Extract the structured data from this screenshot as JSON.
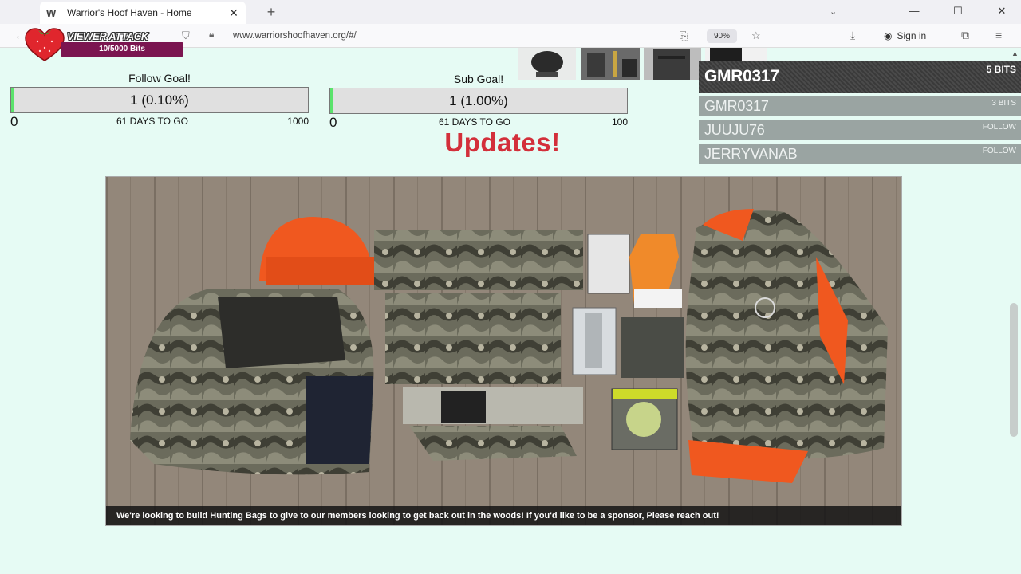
{
  "browser": {
    "tab_title": "Warrior's Hoof Haven - Home",
    "url": "www.warriorshoofhaven.org/#/",
    "zoom": "90%",
    "sign_in": "Sign in"
  },
  "viewer_attack": {
    "title": "VIEWER ATTACK",
    "progress_text": "10/5000 Bits"
  },
  "follow_goal": {
    "label": "Follow Goal!",
    "value_text": "1 (0.10%)",
    "fill_fraction": 0.001,
    "min": "0",
    "days": "61 DAYS TO GO",
    "max": "1000"
  },
  "sub_goal": {
    "label": "Sub Goal!",
    "value_text": "1 (1.00%)",
    "fill_fraction": 0.01,
    "min": "0",
    "days": "61 DAYS TO GO",
    "max": "100"
  },
  "updates_heading": "Updates!",
  "feed": {
    "latest": {
      "name": "GMR0317",
      "amount": "5 BITS"
    },
    "rows": [
      {
        "name": "GMR0317",
        "amount": "3 BITS"
      },
      {
        "name": "JUUJU76",
        "amount": "FOLLOW"
      },
      {
        "name": "JERRYVANAB",
        "amount": "FOLLOW"
      }
    ]
  },
  "photo": {
    "caption": "We're looking to build Hunting Bags to give to our members looking to get back out in the woods! If you'd like to be a sponsor, Please reach out!"
  },
  "colors": {
    "page_bg": "#e6fbf4",
    "updates_red": "#d32f3a",
    "goal_fill": "#5be36c",
    "viewer_attack_bar": "#7b1550"
  }
}
